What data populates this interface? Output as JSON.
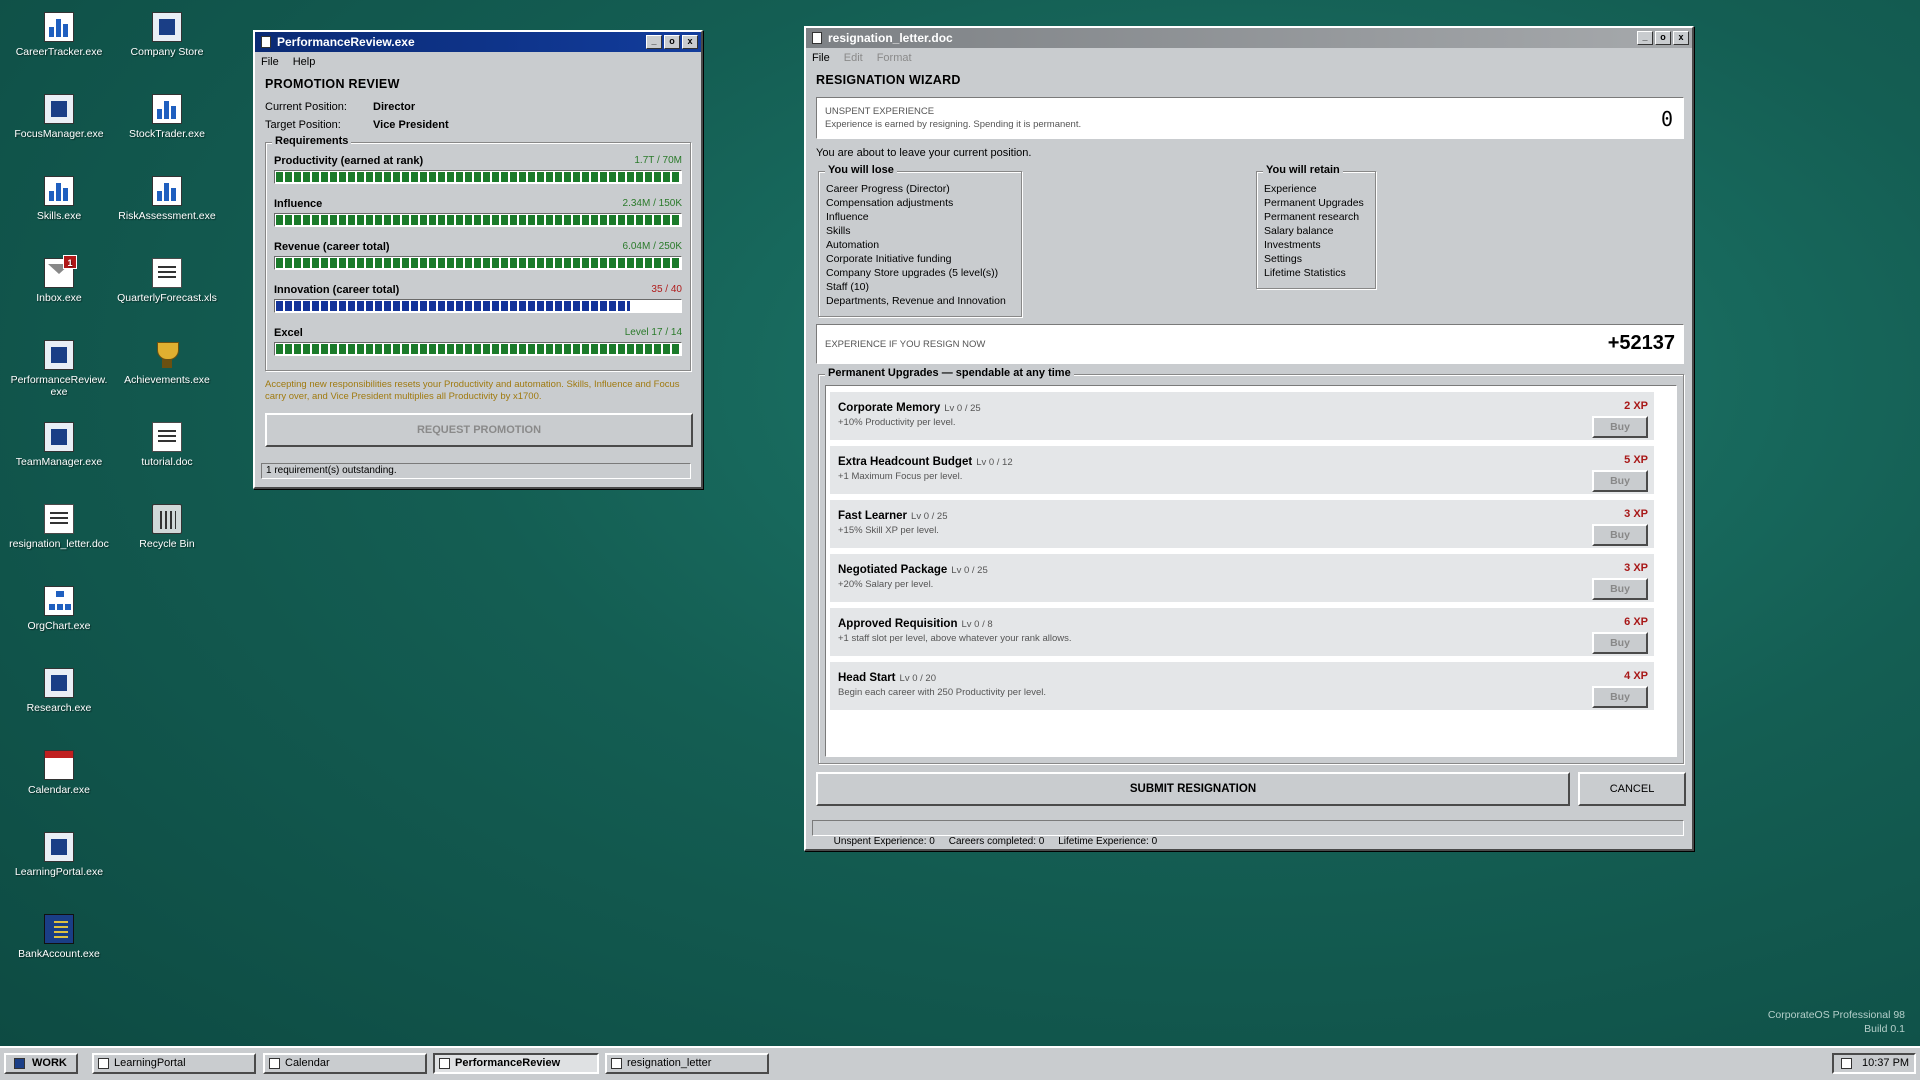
{
  "desktop": {
    "icons_col1": [
      {
        "label": "CareerTracker.exe",
        "icon": "career-tracker-icon"
      },
      {
        "label": "FocusManager.exe",
        "icon": "focus-manager-icon"
      },
      {
        "label": "Skills.exe",
        "icon": "skills-icon"
      },
      {
        "label": "Inbox.exe",
        "icon": "inbox-icon",
        "badge": "1"
      },
      {
        "label": "PerformanceReview.exe",
        "icon": "performance-review-icon"
      },
      {
        "label": "TeamManager.exe",
        "icon": "team-manager-icon"
      },
      {
        "label": "resignation_letter.doc",
        "icon": "document-icon"
      },
      {
        "label": "OrgChart.exe",
        "icon": "org-chart-icon"
      },
      {
        "label": "Research.exe",
        "icon": "research-icon"
      },
      {
        "label": "Calendar.exe",
        "icon": "calendar-icon"
      },
      {
        "label": "LearningPortal.exe",
        "icon": "learning-portal-icon"
      },
      {
        "label": "BankAccount.exe",
        "icon": "bank-account-icon"
      }
    ],
    "icons_col2": [
      {
        "label": "Company Store",
        "icon": "company-store-icon"
      },
      {
        "label": "StockTrader.exe",
        "icon": "stock-trader-icon"
      },
      {
        "label": "RiskAssessment.exe",
        "icon": "risk-assessment-icon"
      },
      {
        "label": "QuarterlyForecast.xls",
        "icon": "spreadsheet-icon"
      },
      {
        "label": "Achievements.exe",
        "icon": "trophy-icon"
      },
      {
        "label": "tutorial.doc",
        "icon": "document-icon"
      },
      {
        "label": "Recycle Bin",
        "icon": "recycle-bin-icon"
      }
    ],
    "branding": {
      "line1": "CorporateOS Professional 98",
      "line2": "Build 0.1"
    }
  },
  "performance_window": {
    "title": "PerformanceReview.exe",
    "menu": [
      "File",
      "Help"
    ],
    "heading": "PROMOTION REVIEW",
    "current_position_label": "Current Position:",
    "current_position": "Director",
    "target_position_label": "Target Position:",
    "target_position": "Vice President",
    "requirements_label": "Requirements",
    "requirements": [
      {
        "name": "Productivity (earned at rank)",
        "value": "1.7T / 70M",
        "progress": 1.0,
        "met": true
      },
      {
        "name": "Influence",
        "value": "2.34M / 150K",
        "progress": 1.0,
        "met": true
      },
      {
        "name": "Revenue (career total)",
        "value": "6.04M / 250K",
        "progress": 1.0,
        "met": true
      },
      {
        "name": "Innovation (career total)",
        "value": "35 / 40",
        "progress": 0.875,
        "met": false
      },
      {
        "name": "Excel",
        "value": "Level 17 / 14",
        "progress": 1.0,
        "met": true
      }
    ],
    "warning": "Accepting new responsibilities resets your Productivity and automation. Skills, Influence and Focus carry over, and Vice President multiplies all Productivity by x1700.",
    "button": "REQUEST PROMOTION",
    "status": "1 requirement(s) outstanding."
  },
  "resignation_window": {
    "title": "resignation_letter.doc",
    "menu": [
      "File",
      "Edit",
      "Format"
    ],
    "heading": "RESIGNATION WIZARD",
    "unspent_label": "UNSPENT EXPERIENCE",
    "unspent_note": "Experience is earned by resigning. Spending it is permanent.",
    "unspent_value": "0",
    "leave_text": "You are about to leave your current position.",
    "lose_label": "You will lose",
    "lose_items": [
      "Career Progress (Director)",
      "Compensation adjustments",
      "Influence",
      "Skills",
      "Automation",
      "Corporate Initiative funding",
      "Company Store upgrades (5 level(s))",
      "Staff (10)",
      "Departments, Revenue and Innovation"
    ],
    "retain_label": "You will retain",
    "retain_items": [
      "Experience",
      "Permanent Upgrades",
      "Permanent research",
      "Salary balance",
      "Investments",
      "Settings",
      "Lifetime Statistics"
    ],
    "resign_xp_label": "EXPERIENCE IF YOU RESIGN NOW",
    "resign_xp_value": "+52137",
    "upgrades_label": "Permanent Upgrades — spendable at any time",
    "upgrades": [
      {
        "name": "Corporate Memory",
        "level": "Lv 0 / 25",
        "desc": "+10% Productivity per level.",
        "cost": "2 XP",
        "buy": "Buy"
      },
      {
        "name": "Extra Headcount Budget",
        "level": "Lv 0 / 12",
        "desc": "+1 Maximum Focus per level.",
        "cost": "5 XP",
        "buy": "Buy"
      },
      {
        "name": "Fast Learner",
        "level": "Lv 0 / 25",
        "desc": "+15% Skill XP per level.",
        "cost": "3 XP",
        "buy": "Buy"
      },
      {
        "name": "Negotiated Package",
        "level": "Lv 0 / 25",
        "desc": "+20% Salary per level.",
        "cost": "3 XP",
        "buy": "Buy"
      },
      {
        "name": "Approved Requisition",
        "level": "Lv 0 / 8",
        "desc": "+1 staff slot per level, above whatever your rank allows.",
        "cost": "6 XP",
        "buy": "Buy"
      },
      {
        "name": "Head Start",
        "level": "Lv 0 / 20",
        "desc": "Begin each career with 250 Productivity per level.",
        "cost": "4 XP",
        "buy": "Buy"
      }
    ],
    "submit": "SUBMIT RESIGNATION",
    "cancel": "CANCEL",
    "status": "Unspent Experience: 0     Careers completed: 0     Lifetime Experience: 0"
  },
  "taskbar": {
    "start": "WORK",
    "items": [
      {
        "label": "LearningPortal",
        "active": false
      },
      {
        "label": "Calendar",
        "active": false
      },
      {
        "label": "PerformanceReview",
        "active": true
      },
      {
        "label": "resignation_letter",
        "active": false
      }
    ],
    "clock": "10:37 PM"
  }
}
